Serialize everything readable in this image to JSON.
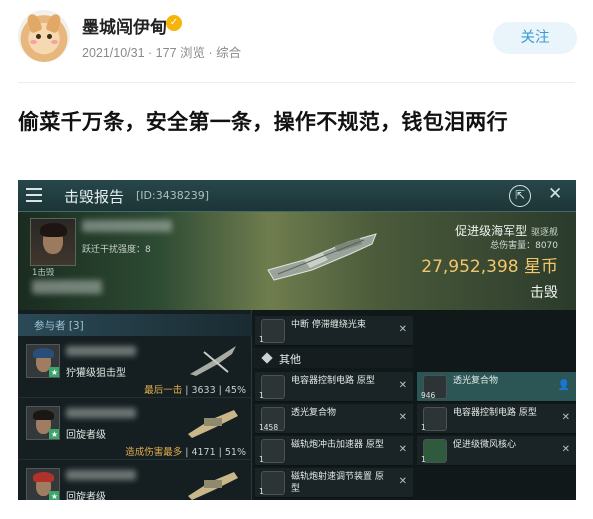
{
  "post": {
    "author": "墨城闯伊甸",
    "badge_icon": "verified-badge-icon",
    "meta": "2021/10/31 · 177 浏览 · 综合",
    "follow_label": "关注",
    "headline": "偷菜千万条，安全第一条，操作不规范，钱包泪两行"
  },
  "game": {
    "title": "击毁报告",
    "report_id": "[ID:3438239]",
    "pilot_subtitle": "跃迁干扰强度：8",
    "pilot_small": "1击毁",
    "victim": {
      "ship": "促进级海军型",
      "ship_class": "驱逐舰",
      "damage_label": "总伤害量：8070",
      "isk": "27,952,398 星币",
      "verdict": "击毁"
    },
    "participants": {
      "header": "参与者 [3]",
      "rows": [
        {
          "ship": "狞獾级狙击型",
          "stats_prefix": "最后一击",
          "stats": " | 3633 | 45%"
        },
        {
          "ship": "回旋者级",
          "stats_prefix": "造成伤害最多",
          "stats": " | 4171 | 51%"
        },
        {
          "ship": "回旋者级",
          "stats_prefix": "",
          "stats": ""
        }
      ]
    },
    "items": {
      "top": {
        "qty": "1",
        "name": "中断 停滞缠绕光束"
      },
      "section": "其他",
      "left": [
        {
          "qty": "1",
          "name": "电容器控制电路 原型"
        },
        {
          "qty": "1458",
          "name": "透光复合物"
        },
        {
          "qty": "1",
          "name": "磁轨炮冲击加速器 原型"
        },
        {
          "qty": "1",
          "name": "磁轨炮射速调节装置 原型"
        }
      ],
      "right": [
        {
          "qty": "946",
          "name": "透光复合物"
        },
        {
          "qty": "1",
          "name": "电容器控制电路 原型"
        },
        {
          "qty": "1",
          "name": "促进级微风核心"
        }
      ]
    },
    "colors": {
      "accent_isk": "#f4c66a",
      "highlight_row": "#2c5555",
      "follow_text": "#3a9bd5"
    }
  }
}
